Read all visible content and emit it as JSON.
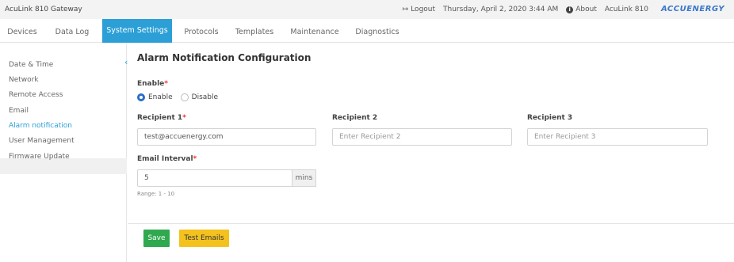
{
  "topbar": {
    "app_title": "AcuLink 810 Gateway",
    "logout": "Logout",
    "datetime": "Thursday, April 2, 2020 3:44 AM",
    "about": "About",
    "device": "AcuLink 810",
    "brand": "ACCUENERGY",
    "brand_color": "#3b77c8"
  },
  "nav": {
    "tabs": [
      "Devices",
      "Data Log",
      "System Settings",
      "Protocols",
      "Templates",
      "Maintenance",
      "Diagnostics"
    ],
    "active": "System Settings",
    "accent": "#2b9fd6"
  },
  "sidebar": {
    "items": [
      "Date & Time",
      "Network",
      "Remote Access",
      "Email",
      "Alarm notification",
      "User Management",
      "Firmware Update"
    ],
    "active": "Alarm notification"
  },
  "main": {
    "title": "Alarm Notification Configuration",
    "enable_label": "Enable",
    "radio_enable": "Enable",
    "radio_disable": "Disable",
    "recipient1_label": "Recipient 1",
    "recipient1_value": "test@accuenergy.com",
    "recipient2_label": "Recipient 2",
    "recipient2_placeholder": "Enter Recipient 2",
    "recipient3_label": "Recipient 3",
    "recipient3_placeholder": "Enter Recipient 3",
    "interval_label": "Email Interval",
    "interval_value": "5",
    "interval_unit": "mins",
    "interval_hint": "Range: 1 - 10",
    "required_mark": "*"
  },
  "actions": {
    "save": "Save",
    "test": "Test Emails",
    "save_color": "#2fa84f",
    "test_color": "#f4c21f"
  }
}
